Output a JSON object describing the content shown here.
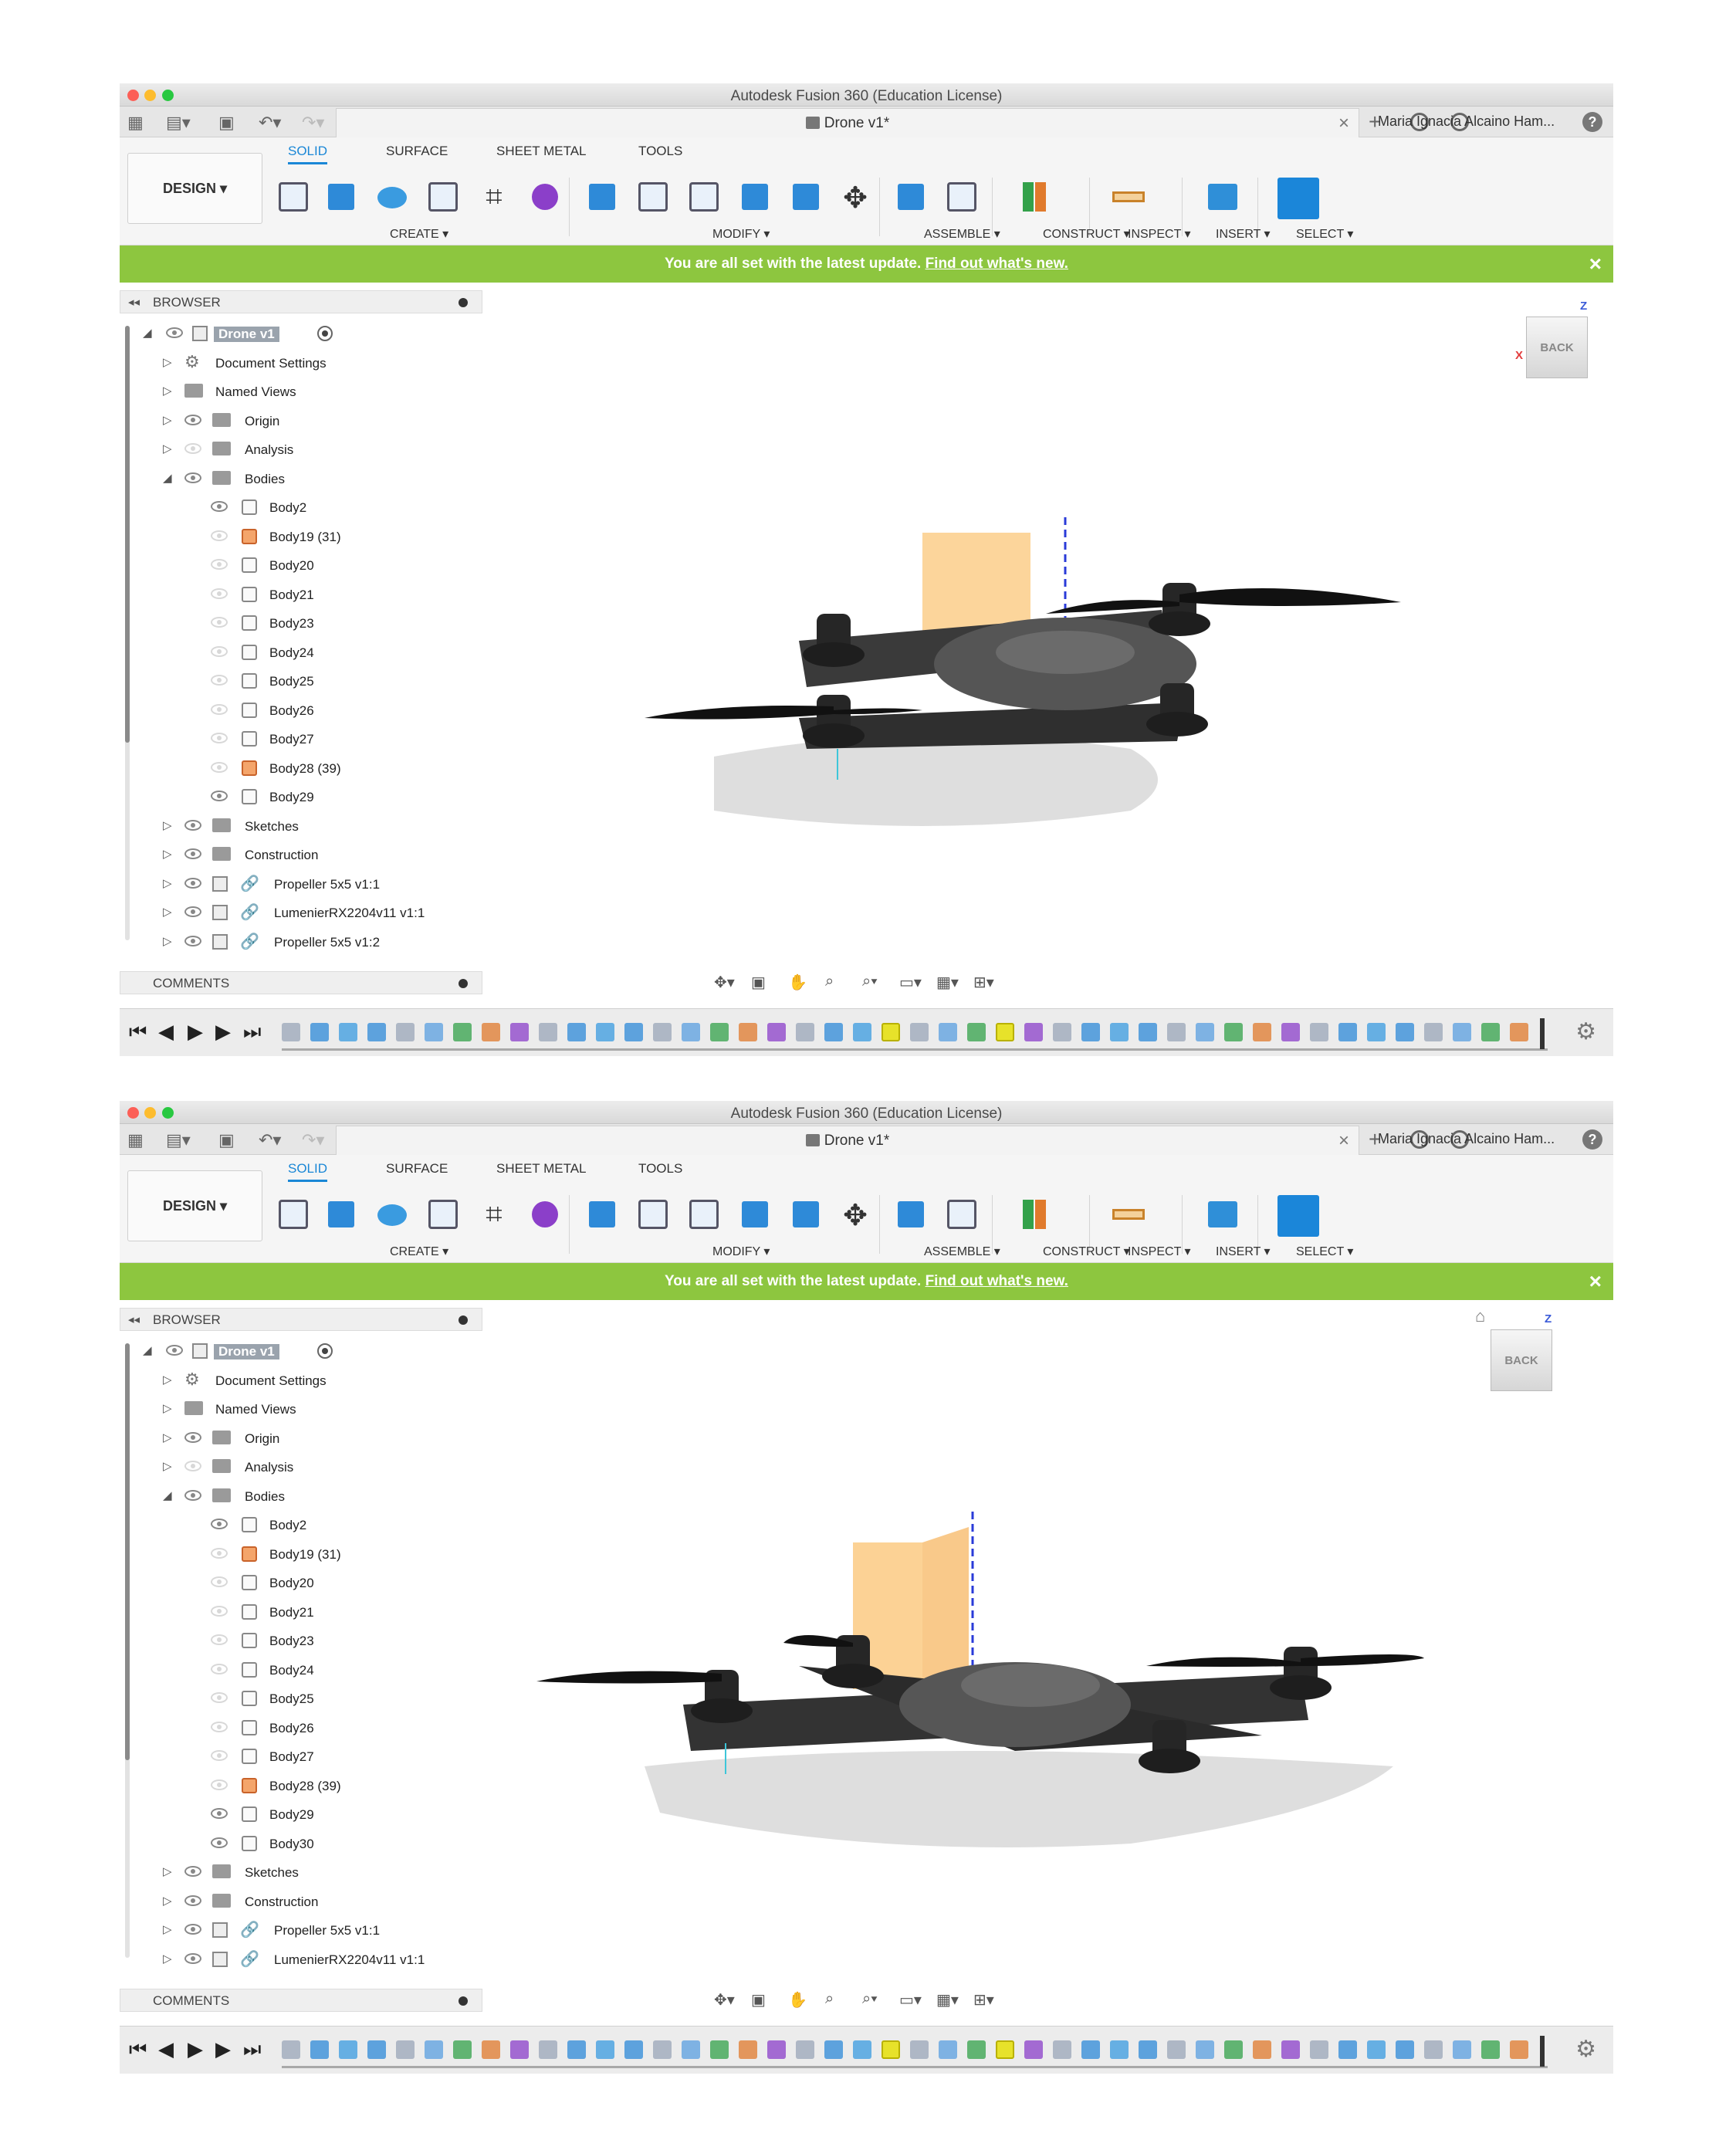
{
  "window": {
    "title": "Autodesk Fusion 360 (Education License)",
    "doc_tab": "Drone v1*",
    "user": "Maria Ignacia Alcaino Ham..."
  },
  "ribbon": {
    "workspace": "DESIGN",
    "tabs": [
      "SOLID",
      "SURFACE",
      "SHEET METAL",
      "TOOLS"
    ],
    "groups": [
      "CREATE",
      "MODIFY",
      "ASSEMBLE",
      "CONSTRUCT",
      "INSPECT",
      "INSERT",
      "SELECT"
    ]
  },
  "notification": {
    "text": "You are all set with the latest update.",
    "link": "Find out what's new."
  },
  "browser": {
    "title": "BROWSER",
    "root": "Drone v1",
    "folders": [
      "Document Settings",
      "Named Views",
      "Origin",
      "Analysis",
      "Bodies"
    ],
    "bottom_folders": [
      "Sketches",
      "Construction"
    ],
    "components": [
      "Propeller 5x5 v1:1",
      "LumenierRX2204v11 v1:1",
      "Propeller 5x5 v1:2"
    ],
    "bodies_1": [
      "Body2",
      "Body19 (31)",
      "Body20",
      "Body21",
      "Body23",
      "Body24",
      "Body25",
      "Body26",
      "Body27",
      "Body28 (39)",
      "Body29"
    ],
    "bodies_2": [
      "Body2",
      "Body19 (31)",
      "Body20",
      "Body21",
      "Body23",
      "Body24",
      "Body25",
      "Body26",
      "Body27",
      "Body28 (39)",
      "Body29",
      "Body30"
    ]
  },
  "viewcube": {
    "face": "BACK",
    "axis_z": "Z",
    "axis_x": "X"
  },
  "comments": {
    "title": "COMMENTS"
  },
  "colors": {
    "accent": "#1a87d6",
    "notify": "#8dc63f",
    "timeline_highlight": "#e7e22a"
  }
}
